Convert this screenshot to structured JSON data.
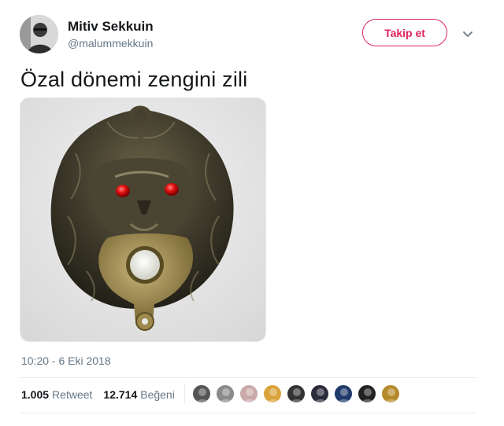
{
  "user": {
    "name": "Mitiv Sekkuin",
    "handle": "@malummekkuin"
  },
  "actions": {
    "follow_label": "Takip et",
    "menu_icon": "chevron-down-icon"
  },
  "tweet": {
    "text": "Özal dönemi zengini zili",
    "timestamp": "10:20 - 6 Eki 2018"
  },
  "stats": {
    "retweets_count": "1.005",
    "retweets_label": "Retweet",
    "likes_count": "12.714",
    "likes_label": "Beğeni"
  },
  "colors": {
    "accent": "#e0245e",
    "secondary_text": "#657786",
    "divider": "#e6ecf0"
  },
  "likers": [
    {
      "icon": "user-avatar-1",
      "color": "#555555"
    },
    {
      "icon": "user-avatar-2",
      "color": "#8a8a8a"
    },
    {
      "icon": "user-avatar-3",
      "color": "#c9a9a9"
    },
    {
      "icon": "user-avatar-4",
      "color": "#d9a23a"
    },
    {
      "icon": "user-avatar-5",
      "color": "#333333"
    },
    {
      "icon": "user-avatar-6",
      "color": "#2b2b3b"
    },
    {
      "icon": "user-avatar-7",
      "color": "#1f3a6b"
    },
    {
      "icon": "user-avatar-8",
      "color": "#222222"
    },
    {
      "icon": "user-avatar-9",
      "color": "#b58a2a"
    }
  ]
}
